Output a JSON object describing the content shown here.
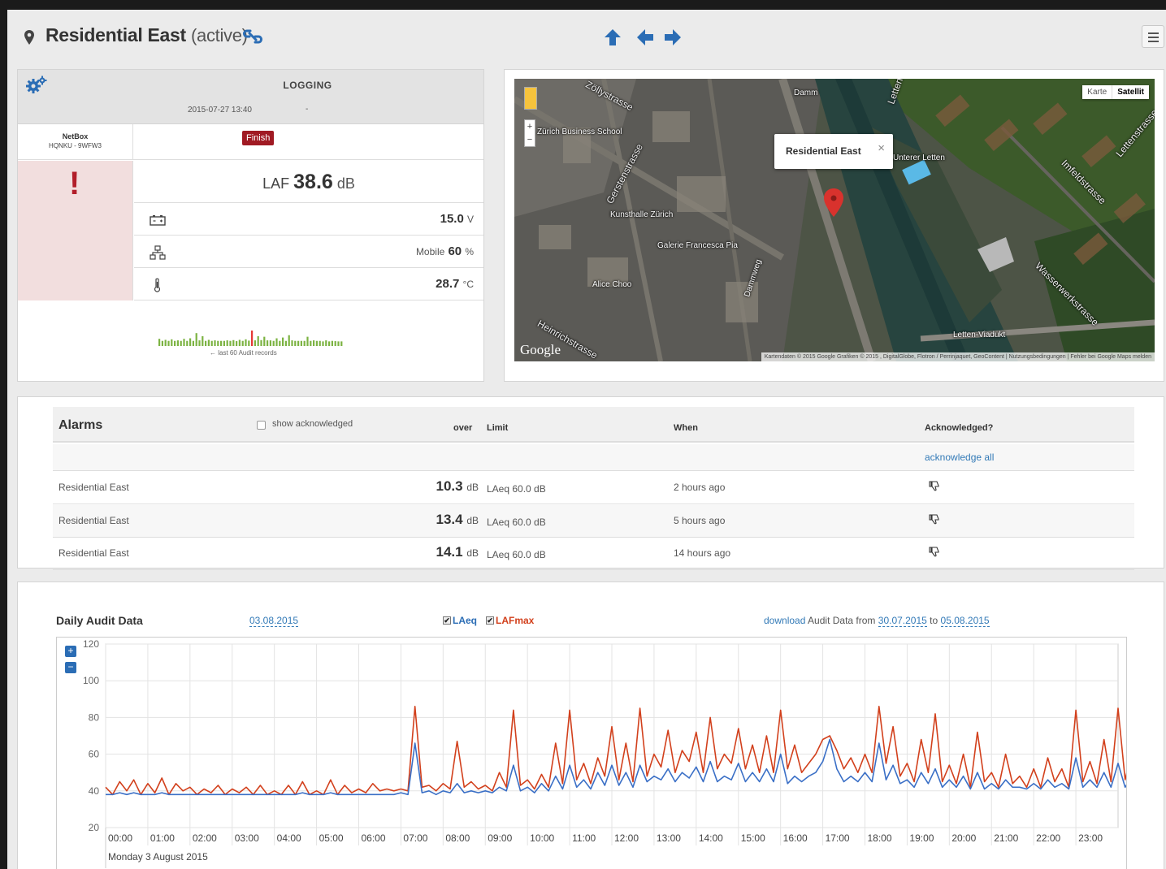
{
  "header": {
    "title": "Residential East",
    "status": "(active)"
  },
  "logging": {
    "title": "LOGGING",
    "start": "2015-07-27 13:40",
    "end": "-",
    "device_name": "NetBox",
    "device_id": "HQNKU - 9WFW3",
    "finish_label": "Finish",
    "alert_symbol": "!",
    "laf_label": "LAF",
    "laf_value": "38.6",
    "laf_unit": "dB",
    "battery_value": "15.0",
    "battery_unit": "V",
    "network_prefix": "Mobile",
    "network_value": "60",
    "network_unit": "%",
    "temp_value": "28.7",
    "temp_unit": "°C",
    "mini_caption": "← last 60 Audit records"
  },
  "map": {
    "type_options": [
      "Karte",
      "Satellit"
    ],
    "selected_type": "Satellit",
    "info_title": "Residential East",
    "info_close": "×",
    "google": "Google",
    "attribution": "Kartendaten © 2015 Google Grafiken © 2015 , DigitalGlobe, Flotron / Perrinjaquet, GeoContent  |  Nutzungsbedingungen  |  Fehler bei Google Maps melden",
    "labels": [
      "Zöllystrasse",
      "Zürich Business School",
      "Gerstenstrasse",
      "Kunsthalle Zürich",
      "Galerie Francesca Pia",
      "Alice Choo",
      "Dammweg",
      "Damm",
      "Unterer Letten",
      "Imfeldstrasse",
      "Lettenstrasse",
      "Wasserwerkstrasse",
      "Letten-Viadukt",
      "Heinrichstrasse",
      "Letten"
    ]
  },
  "alarms": {
    "title": "Alarms",
    "show_ack_label": "show acknowledged",
    "col_over": "over",
    "col_limit": "Limit",
    "col_when": "When",
    "col_ack": "Acknowledged?",
    "ack_all": "acknowledge all",
    "rows": [
      {
        "location": "Residential East",
        "over": "10.3",
        "unit": "dB",
        "limit": "LAeq 60.0 dB",
        "when": "2 hours ago"
      },
      {
        "location": "Residential East",
        "over": "13.4",
        "unit": "dB",
        "limit": "LAeq 60.0 dB",
        "when": "5 hours ago"
      },
      {
        "location": "Residential East",
        "over": "14.1",
        "unit": "dB",
        "limit": "LAeq 60.0 dB",
        "when": "14 hours ago"
      }
    ]
  },
  "audit": {
    "title": "Daily Audit Data",
    "date": "03.08.2015",
    "legend_laeq": "LAeq",
    "legend_lafmax": "LAFmax",
    "download_link": "download",
    "download_text": "Audit Data from",
    "from_date": "30.07.2015",
    "to_text": "to",
    "to_date": "05.08.2015",
    "zoom_in": "+",
    "zoom_out": "−"
  },
  "colors": {
    "laeq": "#3a6fc6",
    "lafmax": "#d2401c",
    "link": "#337ab7",
    "finish": "#a01a23",
    "alert_bg": "#f2dede",
    "mini_bar": "#7cb342",
    "mini_peak": "#e53935"
  },
  "chart_data": {
    "type": "line",
    "x_start": "00:00",
    "x_end": "24:00",
    "x_ticks": [
      "00:00",
      "01:00",
      "02:00",
      "03:00",
      "04:00",
      "05:00",
      "06:00",
      "07:00",
      "08:00",
      "09:00",
      "10:00",
      "11:00",
      "12:00",
      "13:00",
      "14:00",
      "15:00",
      "16:00",
      "17:00",
      "18:00",
      "19:00",
      "20:00",
      "21:00",
      "22:00",
      "23:00"
    ],
    "x_sublabel": "Monday 3 August 2015",
    "ylim": [
      20,
      120
    ],
    "y_ticks": [
      20,
      40,
      60,
      80,
      100,
      120
    ],
    "grid": true,
    "series": [
      {
        "name": "LAFmax",
        "color": "#d2401c",
        "interval_min": 10,
        "values": [
          42,
          38,
          45,
          40,
          46,
          38,
          44,
          39,
          47,
          38,
          44,
          40,
          42,
          38,
          41,
          39,
          43,
          38,
          41,
          39,
          42,
          38,
          43,
          38,
          40,
          38,
          43,
          38,
          45,
          38,
          40,
          38,
          46,
          38,
          43,
          39,
          41,
          39,
          44,
          40,
          41,
          40,
          41,
          40,
          86,
          42,
          43,
          40,
          44,
          41,
          67,
          42,
          45,
          41,
          43,
          40,
          50,
          42,
          84,
          43,
          46,
          41,
          49,
          42,
          66,
          44,
          84,
          46,
          55,
          44,
          58,
          48,
          75,
          46,
          66,
          45,
          85,
          48,
          60,
          53,
          73,
          50,
          62,
          56,
          72,
          50,
          80,
          52,
          60,
          55,
          74,
          52,
          65,
          50,
          70,
          50,
          84,
          52,
          65,
          50,
          55,
          60,
          68,
          70,
          62,
          52,
          58,
          50,
          60,
          50,
          86,
          55,
          75,
          48,
          55,
          45,
          68,
          50,
          82,
          45,
          54,
          44,
          60,
          42,
          72,
          45,
          50,
          42,
          60,
          44,
          48,
          42,
          52,
          42,
          58,
          45,
          52,
          42,
          84,
          45,
          56,
          44,
          68,
          45,
          85,
          46,
          62,
          43,
          55,
          44,
          78,
          45,
          66,
          44,
          60,
          42,
          80,
          44,
          62,
          44,
          56,
          44,
          60,
          46,
          86,
          48,
          72,
          45,
          60,
          44,
          75,
          46,
          72,
          44,
          84,
          45,
          60,
          46,
          64,
          44,
          74,
          46,
          60,
          44,
          70,
          44,
          55,
          44,
          66,
          44,
          72,
          45,
          60,
          44,
          50,
          42,
          46,
          42,
          48,
          42,
          44,
          42,
          50,
          42,
          52,
          42,
          72,
          44,
          60,
          42,
          46,
          42,
          44,
          42,
          42,
          42,
          44,
          42,
          45,
          41,
          46,
          42,
          48,
          43,
          82,
          44,
          60,
          45,
          58,
          44,
          44,
          42,
          52,
          42,
          55,
          42,
          64,
          44,
          42,
          42,
          42,
          42,
          58,
          42,
          44,
          42,
          42,
          40,
          44,
          40,
          42,
          41,
          40,
          40
        ]
      },
      {
        "name": "LAeq",
        "color": "#3a6fc6",
        "interval_min": 10,
        "values": [
          38,
          38,
          39,
          38,
          39,
          38,
          38,
          38,
          39,
          38,
          38,
          38,
          38,
          38,
          38,
          38,
          38,
          38,
          38,
          38,
          38,
          38,
          38,
          38,
          38,
          38,
          38,
          38,
          39,
          38,
          38,
          38,
          39,
          38,
          38,
          38,
          38,
          38,
          38,
          38,
          38,
          38,
          39,
          38,
          66,
          39,
          40,
          38,
          40,
          39,
          44,
          39,
          40,
          39,
          40,
          39,
          42,
          40,
          54,
          40,
          42,
          39,
          44,
          40,
          48,
          41,
          54,
          42,
          46,
          41,
          50,
          43,
          54,
          43,
          50,
          42,
          54,
          45,
          48,
          46,
          52,
          45,
          50,
          47,
          53,
          45,
          56,
          45,
          48,
          46,
          55,
          45,
          50,
          45,
          52,
          45,
          60,
          44,
          48,
          45,
          48,
          50,
          56,
          68,
          52,
          45,
          48,
          45,
          50,
          45,
          66,
          46,
          54,
          44,
          46,
          42,
          50,
          44,
          52,
          42,
          46,
          42,
          48,
          41,
          50,
          41,
          44,
          41,
          46,
          42,
          42,
          41,
          44,
          41,
          46,
          42,
          44,
          41,
          58,
          42,
          46,
          42,
          50,
          42,
          55,
          42,
          48,
          41,
          44,
          42,
          52,
          42,
          48,
          42,
          46,
          41,
          52,
          42,
          48,
          42,
          44,
          42,
          46,
          42,
          54,
          43,
          50,
          42,
          48,
          42,
          50,
          42,
          50,
          42,
          56,
          42,
          48,
          43,
          48,
          42,
          52,
          42,
          46,
          42,
          48,
          42,
          44,
          42,
          48,
          42,
          50,
          42,
          46,
          42,
          42,
          41,
          42,
          41,
          42,
          41,
          41,
          41,
          42,
          41,
          42,
          41,
          50,
          42,
          46,
          41,
          42,
          41,
          41,
          41,
          41,
          41,
          41,
          41,
          41,
          40,
          42,
          41,
          42,
          41,
          60,
          42,
          46,
          42,
          46,
          41,
          41,
          41,
          44,
          41,
          44,
          41,
          52,
          42,
          40,
          40,
          40,
          40,
          50,
          40,
          40,
          40,
          40,
          40,
          40,
          40,
          40,
          40,
          40,
          40
        ]
      }
    ]
  }
}
